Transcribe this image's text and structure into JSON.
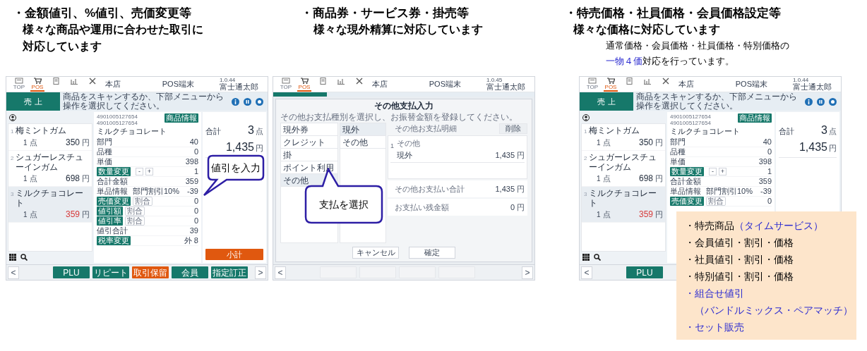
{
  "columns": [
    {
      "heading": "・金額値引、%値引、売価変更等",
      "subheading": "様々な商品や運用に合わせた取引に対応しています",
      "screen": {
        "kind": "sales",
        "top_bar": {
          "nav": [
            {
              "label": "TOP",
              "selected": false
            },
            {
              "label": "POS",
              "selected": true
            },
            {
              "selected": false
            },
            {
              "selected": false
            },
            {
              "selected": false
            }
          ],
          "store": "本店",
          "terminal": "POS端末",
          "version": "1.0.44",
          "user": "富士通太郎"
        },
        "mode_button": "売 上",
        "message": "商品をスキャンするか、下部メニューから操作を選択してください。",
        "items": [
          {
            "index": "1",
            "name": "梅ミントガム",
            "qty": "1",
            "qty_unit": "点",
            "price": "350",
            "currency": "円",
            "selected": false,
            "discounted": false
          },
          {
            "index": "2",
            "name": "シュガーレスチューインガム",
            "qty": "1",
            "qty_unit": "点",
            "price": "698",
            "currency": "円",
            "selected": false,
            "discounted": false
          },
          {
            "index": "3",
            "name": "ミルクチョコレート",
            "qty": "1",
            "qty_unit": "点",
            "price": "359",
            "currency": "円",
            "selected": true,
            "discounted": true
          }
        ],
        "detail": {
          "barcodes": [
            "4901005127654",
            "4901005127654"
          ],
          "info_button": "商品情報",
          "name": "ミルクチョコレート",
          "rows": [
            {
              "kind": "field",
              "label": "部門",
              "value": "40"
            },
            {
              "kind": "field",
              "label": "品種",
              "value": "0"
            },
            {
              "kind": "field",
              "label": "単価",
              "value": "398"
            },
            {
              "kind": "quantity",
              "button": "数量変更",
              "minus": "-",
              "plus": "+",
              "value": "1"
            },
            {
              "kind": "field",
              "label": "合計金額",
              "value": "359"
            },
            {
              "kind": "info",
              "label": "単品情報",
              "detail": "部門割引10%",
              "value": "-39"
            },
            {
              "kind": "adjust",
              "button": "売価変更",
              "chip": "割合",
              "value": "0"
            },
            {
              "kind": "adjust",
              "button": "値引額",
              "chip": "割合",
              "value": "0"
            },
            {
              "kind": "adjust",
              "button": "値引率",
              "chip": "割合",
              "value": "0"
            },
            {
              "kind": "field",
              "label": "値引合計",
              "value": "39"
            },
            {
              "kind": "button_value",
              "button": "税率変更",
              "value": "外 8"
            }
          ]
        },
        "summary": {
          "label": "合計",
          "count": "3",
          "count_unit": "点",
          "amount": "1,435",
          "currency": "円",
          "button": "小計"
        },
        "callout": "値引を入力",
        "bottom": {
          "prev": "<",
          "next": ">",
          "buttons": [
            {
              "label": "PLU",
              "kind": "normal"
            },
            {
              "label": "リピート",
              "kind": "normal"
            },
            {
              "label": "取引保留",
              "kind": "warning"
            },
            {
              "label": "会員",
              "kind": "normal"
            },
            {
              "label": "指定訂正",
              "kind": "normal"
            }
          ]
        }
      }
    },
    {
      "heading": "・商品券・サービス券・掛売等",
      "subheading": "様々な現外精算に対応しています",
      "screen": {
        "kind": "payment",
        "top_bar": {
          "nav": [
            {
              "label": "TOP",
              "selected": false
            },
            {
              "label": "POS",
              "selected": true
            },
            {
              "selected": false
            },
            {
              "selected": false
            },
            {
              "selected": false
            }
          ],
          "store": "本店",
          "terminal": "POS端末",
          "version": "1.0.45",
          "user": "富士通太郎"
        },
        "dialog": {
          "title": "その他支払入力",
          "instruction": "その他お支払種別を選択し、お振替金額を登録してください。",
          "types": [
            {
              "label": "現外券",
              "selected": false
            },
            {
              "label": "クレジット",
              "selected": false
            },
            {
              "label": "掛",
              "selected": false
            },
            {
              "label": "ポイント利用",
              "selected": false
            },
            {
              "label": "その他",
              "selected": true
            }
          ],
          "subtypes": [
            {
              "label": "現外",
              "selected": true
            },
            {
              "label": "その他",
              "selected": false
            }
          ],
          "details_label": "その他お支払明細",
          "delete_button": "削除",
          "lines": [
            {
              "index": "1",
              "category": "その他",
              "name": "現外",
              "amount": "1,435",
              "currency": "円"
            }
          ],
          "totals": [
            {
              "label": "その他お支払い合計",
              "amount": "1,435",
              "currency": "円"
            },
            {
              "label": "お支払い残金額",
              "amount": "0",
              "currency": "円"
            }
          ],
          "buttons": [
            "キャンセル",
            "確定"
          ]
        },
        "callout": "支払を選択",
        "bottom": {
          "prev": "<",
          "next": ">",
          "buttons": [
            {
              "disabled": true
            },
            {
              "disabled": true
            },
            {
              "disabled": true
            },
            {
              "disabled": true
            }
          ]
        }
      }
    },
    {
      "heading": "・特売価格・社員価格・会員価格設定等",
      "subheading": "様々な価格に対応しています",
      "note": [
        {
          "text": "通常価格・会員価格・社員価格・特別価格の\n",
          "highlight": false
        },
        {
          "text": "一物４価",
          "highlight": true
        },
        {
          "text": "対応を行っています。",
          "highlight": false
        }
      ],
      "screen": {
        "kind": "sales",
        "top_bar": {
          "nav": [
            {
              "label": "TOP",
              "selected": false
            },
            {
              "label": "POS",
              "selected": true
            },
            {
              "selected": false
            },
            {
              "selected": false
            },
            {
              "selected": false
            }
          ],
          "store": "本店",
          "terminal": "POS端末",
          "version": "1.0.44",
          "user": "富士通太郎"
        },
        "mode_button": "売 上",
        "message": "商品をスキャンするか、下部メニューから操作を選択してください。",
        "items": [
          {
            "index": "1",
            "name": "梅ミントガム",
            "qty": "1",
            "qty_unit": "点",
            "price": "350",
            "currency": "円",
            "selected": false,
            "discounted": false
          },
          {
            "index": "2",
            "name": "シュガーレスチューインガム",
            "qty": "1",
            "qty_unit": "点",
            "price": "698",
            "currency": "円",
            "selected": false,
            "discounted": false
          },
          {
            "index": "3",
            "name": "ミルクチョコレート",
            "qty": "1",
            "qty_unit": "点",
            "price": "359",
            "currency": "円",
            "selected": true,
            "discounted": true
          }
        ],
        "detail": {
          "barcodes": [
            "4901005127654",
            "4901005127654"
          ],
          "info_button": "商品情報",
          "name": "ミルクチョコレート",
          "rows": [
            {
              "kind": "field",
              "label": "部門",
              "value": "40"
            },
            {
              "kind": "field",
              "label": "品種",
              "value": "0"
            },
            {
              "kind": "field",
              "label": "単価",
              "value": "398"
            },
            {
              "kind": "quantity",
              "button": "数量変更",
              "minus": "-",
              "plus": "+",
              "value": "1"
            },
            {
              "kind": "field",
              "label": "合計金額",
              "value": "359"
            },
            {
              "kind": "info",
              "label": "単品情報",
              "detail": "部門割引10%",
              "value": "-39"
            },
            {
              "kind": "adjust",
              "button": "売価変更",
              "chip": "割合",
              "value": "0"
            }
          ]
        },
        "summary": {
          "label": "合計",
          "count": "3",
          "count_unit": "点",
          "amount": "1,435",
          "currency": "円"
        },
        "bottom": {
          "prev": "<",
          "buttons": [
            {
              "label": "PLU",
              "kind": "normal"
            }
          ]
        }
      },
      "feature_box": [
        {
          "parts": [
            {
              "text": "・特売商品",
              "highlight": false
            },
            {
              "text": "（タイムサービス）",
              "highlight": true
            }
          ],
          "indent": false
        },
        {
          "parts": [
            {
              "text": "・会員値引・割引・価格",
              "highlight": false
            }
          ],
          "indent": false
        },
        {
          "parts": [
            {
              "text": "・社員値引・割引・価格",
              "highlight": false
            }
          ],
          "indent": false
        },
        {
          "parts": [
            {
              "text": "・特別値引・割引・価格",
              "highlight": false
            }
          ],
          "indent": false
        },
        {
          "parts": [
            {
              "text": "・組合せ値引",
              "highlight": true
            }
          ],
          "indent": false
        },
        {
          "parts": [
            {
              "text": "（バンドルミックス・ペアマッチ）",
              "highlight": true
            }
          ],
          "indent": true
        },
        {
          "parts": [
            {
              "text": "・セット販売",
              "highlight": true
            }
          ],
          "indent": false
        }
      ]
    }
  ]
}
